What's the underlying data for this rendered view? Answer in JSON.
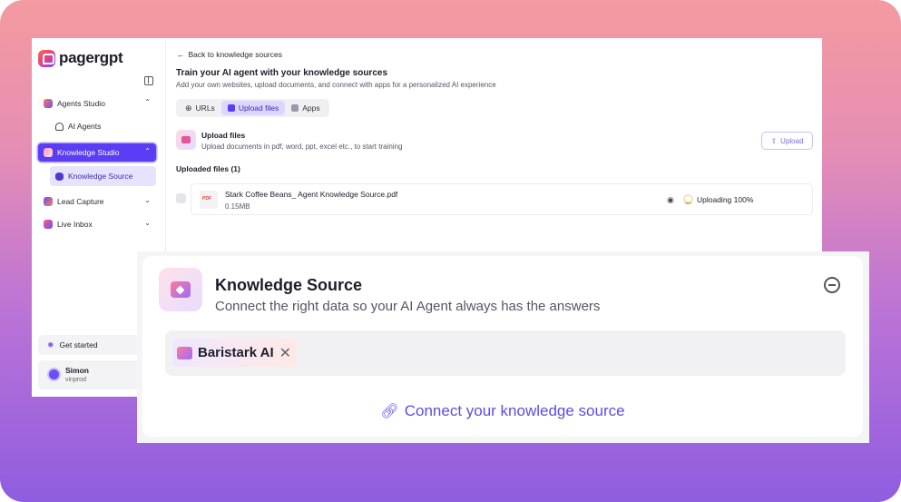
{
  "brand": {
    "name": "pagergpt"
  },
  "sidebar": {
    "items": [
      {
        "label": "Agents Studio",
        "chevron": "⌃"
      },
      {
        "label": "AI Agents"
      },
      {
        "label": "Knowledge Studio",
        "chevron": "⌃"
      },
      {
        "label": "Knowledge Source"
      },
      {
        "label": "Lead Capture",
        "chevron": "⌄"
      },
      {
        "label": "Live Inbox",
        "chevron": "⌄"
      }
    ],
    "get_started": "Get started",
    "user": {
      "name": "Simon",
      "org": "vinprod"
    }
  },
  "main": {
    "back_label": "Back to knowledge sources",
    "title": "Train your AI agent with your knowledge sources",
    "subtitle": "Add your own websites, upload documents, and connect with apps for a personalized AI experience",
    "tabs": [
      {
        "label": "URLs",
        "active": false
      },
      {
        "label": "Upload files",
        "active": true
      },
      {
        "label": "Apps",
        "active": false
      }
    ],
    "upload": {
      "title": "Upload files",
      "description": "Upload documents in pdf, word, ppt, excel etc., to start training",
      "button_label": "Upload"
    },
    "uploaded_heading": "Uploaded files (1)",
    "files": [
      {
        "name": "Stark Coffee Beans_ Agent Knowledge Source.pdf",
        "size": "0.15MB",
        "status": "Uploading 100%"
      }
    ]
  },
  "overlay": {
    "title": "Knowledge Source",
    "subtitle": "Connect the right data so your AI Agent always has the answers",
    "chip_label": "Baristark AI",
    "connect_label": "Connect your knowledge source"
  },
  "colors": {
    "accent": "#5b3df5",
    "link": "#5b4de6",
    "backdrop_top": "#f49aa0",
    "backdrop_bottom": "#8f5de0"
  }
}
